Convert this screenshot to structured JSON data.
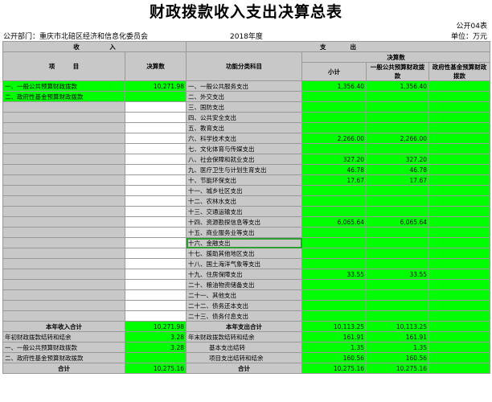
{
  "title": "财政拨款收入支出决算总表",
  "form_code": "公开04表",
  "department": "公开部门：重庆市北碚区经济和信息化委员会",
  "year": "2018年度",
  "unit": "单位：万元",
  "headers": {
    "income": "收　　　　　入",
    "expenditure": "支　　　　出",
    "item": "项　　　目",
    "budget": "决算数",
    "func_item": "功能分类科目",
    "budget_group": "决算数",
    "subtotal": "小计",
    "general_budget": "一般公共预算财政拨款",
    "gov_fund": "政府性基金预算财政拨款"
  },
  "rows": [
    {
      "lt": "一、一般公共预算财政拨款",
      "lv": "10,271.98",
      "rt": "一、一般公共服务支出",
      "a": "1,356.40",
      "b": "1,356.40",
      "c": ""
    },
    {
      "lt": "二、政府性基金预算财政拨款",
      "lv": "",
      "rt": "二、外交支出",
      "a": "",
      "b": "",
      "c": ""
    },
    {
      "lt": "",
      "lv": "",
      "rt": "三、国防支出",
      "a": "",
      "b": "",
      "c": ""
    },
    {
      "lt": "",
      "lv": "",
      "rt": "四、公共安全支出",
      "a": "",
      "b": "",
      "c": ""
    },
    {
      "lt": "",
      "lv": "",
      "rt": "五、教育支出",
      "a": "",
      "b": "",
      "c": ""
    },
    {
      "lt": "",
      "lv": "",
      "rt": "六、科学技术支出",
      "a": "2,266.00",
      "b": "2,266.00",
      "c": ""
    },
    {
      "lt": "",
      "lv": "",
      "rt": "七、文化体育与传媒支出",
      "a": "",
      "b": "",
      "c": ""
    },
    {
      "lt": "",
      "lv": "",
      "rt": "八、社会保障和就业支出",
      "a": "327.20",
      "b": "327.20",
      "c": ""
    },
    {
      "lt": "",
      "lv": "",
      "rt": "九、医疗卫生与计划生育支出",
      "a": "46.78",
      "b": "46.78",
      "c": ""
    },
    {
      "lt": "",
      "lv": "",
      "rt": "十、节能环保支出",
      "a": "17.67",
      "b": "17.67",
      "c": ""
    },
    {
      "lt": "",
      "lv": "",
      "rt": "十一、城乡社区支出",
      "a": "",
      "b": "",
      "c": ""
    },
    {
      "lt": "",
      "lv": "",
      "rt": "十二、农林水支出",
      "a": "",
      "b": "",
      "c": ""
    },
    {
      "lt": "",
      "lv": "",
      "rt": "十三、交通运输支出",
      "a": "",
      "b": "",
      "c": ""
    },
    {
      "lt": "",
      "lv": "",
      "rt": "十四、资源勘探信息等支出",
      "a": "6,065.64",
      "b": "6,065.64",
      "c": ""
    },
    {
      "lt": "",
      "lv": "",
      "rt": "十五、商业服务业等支出",
      "a": "",
      "b": "",
      "c": ""
    },
    {
      "lt": "",
      "lv": "",
      "rt": "十六、金融支出",
      "a": "",
      "b": "",
      "c": ""
    },
    {
      "lt": "",
      "lv": "",
      "rt": "十七、援助其他地区支出",
      "a": "",
      "b": "",
      "c": ""
    },
    {
      "lt": "",
      "lv": "",
      "rt": "十八、国土海洋气象等支出",
      "a": "",
      "b": "",
      "c": ""
    },
    {
      "lt": "",
      "lv": "",
      "rt": "十九、住房保障支出",
      "a": "33.55",
      "b": "33.55",
      "c": ""
    },
    {
      "lt": "",
      "lv": "",
      "rt": "二十、粮油物资储备支出",
      "a": "",
      "b": "",
      "c": ""
    },
    {
      "lt": "",
      "lv": "",
      "rt": "二十一、其他支出",
      "a": "",
      "b": "",
      "c": ""
    },
    {
      "lt": "",
      "lv": "",
      "rt": "二十二、债务还本支出",
      "a": "",
      "b": "",
      "c": ""
    },
    {
      "lt": "",
      "lv": "",
      "rt": "二十三、债务付息支出",
      "a": "",
      "b": "",
      "c": ""
    }
  ],
  "summary": [
    {
      "lt": "本年收入合计",
      "lv": "10,271.98",
      "rt": "本年支出合计",
      "a": "10,113.25",
      "b": "10,113.25",
      "c": ""
    },
    {
      "lt": "年初财政拨款结转和结余",
      "lv": "3.28",
      "rt": "年末财政拨款结转和结余",
      "a": "161.91",
      "b": "161.91",
      "c": ""
    },
    {
      "lt": "一、一般公共预算财政拨款",
      "lv": "3.28",
      "rt": "基本支出结转",
      "a": "1.35",
      "b": "1.35",
      "c": ""
    },
    {
      "lt": "二、政府性基金预算财政拨款",
      "lv": "",
      "rt": "项目支出结转和结余",
      "a": "160.56",
      "b": "160.56",
      "c": ""
    },
    {
      "lt": "合计",
      "lv": "10,275.16",
      "rt": "合计",
      "a": "10,275.16",
      "b": "10,275.16",
      "c": ""
    }
  ]
}
